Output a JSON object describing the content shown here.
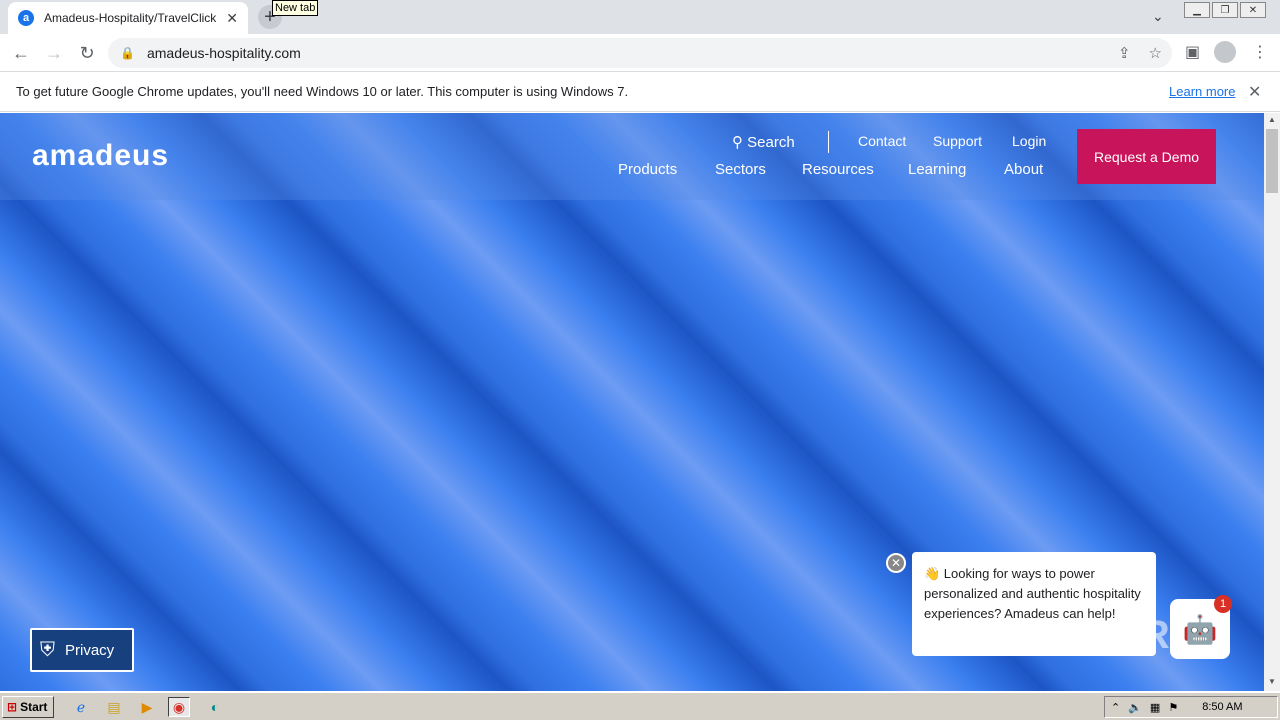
{
  "browser": {
    "tab_title": "Amadeus-Hospitality/TravelClick | Pic",
    "tab_favicon": "a",
    "new_tab_tooltip": "New tab",
    "url": "amadeus-hospitality.com"
  },
  "infobar": {
    "message": "To get future Google Chrome updates, you'll need Windows 10 or later. This computer is using Windows 7.",
    "learn_more": "Learn more"
  },
  "site": {
    "logo": "amadeus",
    "search_label": "Search",
    "utility_links": [
      "Contact",
      "Support",
      "Login"
    ],
    "nav": [
      "Products",
      "Sectors",
      "Resources",
      "Learning",
      "About"
    ],
    "cta": "Request a Demo",
    "privacy_label": "Privacy",
    "chat_message": "👋 Looking for ways to power personalized and authentic hospitality experiences? Amadeus can help!",
    "chat_badge": "1",
    "colors": {
      "cta": "#c8145a",
      "privacy": "#17407f",
      "hero": "#2f6fe0"
    }
  },
  "watermark": "ANY RUN",
  "taskbar": {
    "start_label": "Start",
    "clock": "8:50 AM"
  }
}
